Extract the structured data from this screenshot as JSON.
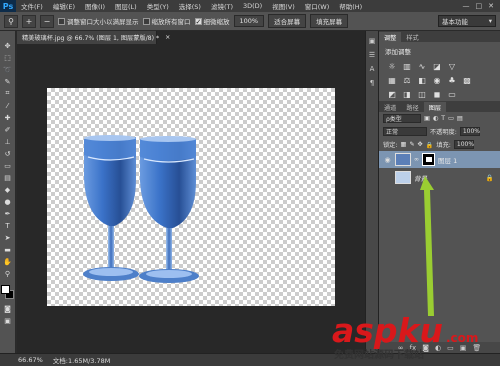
{
  "app": {
    "logo": "Ps"
  },
  "menu": [
    "文件(F)",
    "编辑(E)",
    "图像(I)",
    "图层(L)",
    "类型(Y)",
    "选择(S)",
    "滤镜(T)",
    "3D(D)",
    "视图(V)",
    "窗口(W)",
    "帮助(H)"
  ],
  "window_controls": [
    "—",
    "□",
    "✕"
  ],
  "options": {
    "check_resize": "调整窗口大小以满屏显示",
    "check_all_windows": "缩放所有窗口",
    "check_scrubby": "细微缩放",
    "btn_100": "100%",
    "btn_fit": "适合屏幕",
    "btn_fill": "填充屏幕",
    "workspace": "基本功能"
  },
  "document": {
    "tab_title": "精美玻璃杯.jpg @ 66.7% (图层 1, 图层蒙版/8) *",
    "tab_close": "×",
    "zoom": "66.67%",
    "doc_info": "文档:1.65M/3.78M"
  },
  "panels": {
    "top_tabs": [
      "调整",
      "样式"
    ],
    "adjust_title": "添加调整",
    "layer_tabs": [
      "通道",
      "路径",
      "图层"
    ],
    "kind_label": "ρ类型",
    "blend_mode": "正常",
    "opacity_label": "不透明度:",
    "opacity_value": "100%",
    "lock_label": "锁定:",
    "fill_label": "填充:",
    "fill_value": "100%",
    "layers": [
      {
        "name": "图层 1"
      },
      {
        "name": "背景"
      }
    ]
  },
  "watermark": {
    "text": "aspku",
    "suffix": ".com",
    "sub": "免费网站源码下载站"
  },
  "colors": {
    "arrow": "#9acd32",
    "glass": "#3b73c9",
    "highlight_layer": "#7c95b2"
  }
}
